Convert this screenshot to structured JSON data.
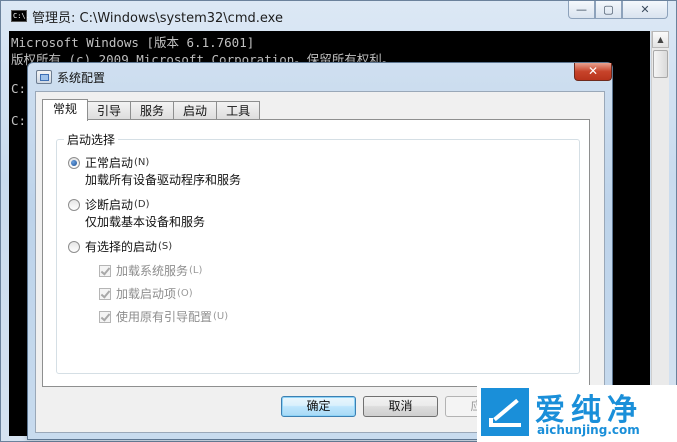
{
  "cmd": {
    "title": "管理员: C:\\Windows\\system32\\cmd.exe",
    "icon_text": "C:\\.",
    "buttons": {
      "minimize": "—",
      "maximize": "▢",
      "close": "✕"
    },
    "console_lines": [
      "Microsoft Windows [版本 6.1.7601]",
      "版权所有 (c) 2009 Microsoft Corporation。保留所有权利。",
      "C:",
      "C:"
    ]
  },
  "dialog": {
    "title": "系统配置",
    "close": "✕",
    "tabs": [
      "常规",
      "引导",
      "服务",
      "启动",
      "工具"
    ],
    "group_title": "启动选择",
    "options": [
      {
        "label": "正常启动",
        "hint": "(N)",
        "description": "加载所有设备驱动程序和服务",
        "checked": true
      },
      {
        "label": "诊断启动",
        "hint": "(D)",
        "description": "仅加载基本设备和服务",
        "checked": false
      },
      {
        "label": "有选择的启动",
        "hint": "(S)",
        "checked": false
      }
    ],
    "sub_options": [
      {
        "label": "加载系统服务",
        "hint": "(L)",
        "checked": true,
        "enabled": false
      },
      {
        "label": "加载启动项",
        "hint": "(O)",
        "checked": true,
        "enabled": false
      },
      {
        "label": "使用原有引导配置",
        "hint": "(U)",
        "checked": true,
        "enabled": false
      }
    ],
    "buttons": {
      "ok": "确定",
      "cancel": "取消",
      "apply": "应用"
    }
  },
  "watermark": {
    "name": "爱纯净",
    "url": "aichunjing.com",
    "color": "#1a8fd9"
  }
}
